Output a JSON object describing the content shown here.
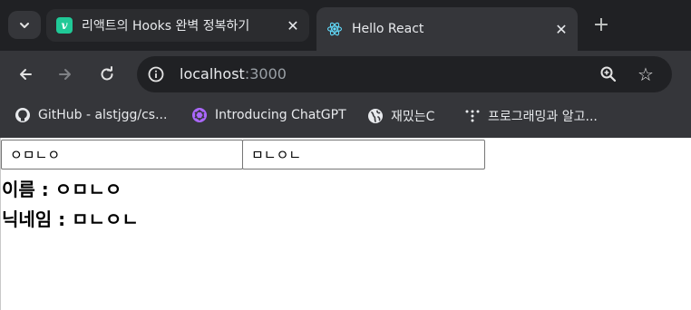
{
  "tabs": [
    {
      "title": "리액트의 Hooks 완벽 정복하기",
      "favicon": "velog-v",
      "favicon_letter": "v",
      "close": "✕"
    },
    {
      "title": "Hello React",
      "favicon": "react-logo",
      "close": "✕"
    }
  ],
  "new_tab": "+",
  "address_bar": {
    "host": "localhost",
    "port": ":3000"
  },
  "bookmarks": [
    {
      "label": "GitHub - alstjgg/cs...",
      "icon": "github-icon"
    },
    {
      "label": "Introducing ChatGPT",
      "icon": "openai-icon"
    },
    {
      "label": "재밌는C",
      "icon": "globe-icon"
    },
    {
      "label": "프로그래밍과 알고...",
      "icon": "dots-icon"
    }
  ],
  "form": {
    "name_value": "ㅇㅁㄴㅇ",
    "nickname_value": "ㅁㄴㅇㄴ"
  },
  "display": {
    "name_label": "이름 :",
    "name_value": "ㅇㅁㄴㅇ",
    "nickname_label": "닉네임 :",
    "nickname_value": "ㅁㄴㅇㄴ"
  },
  "colors": {
    "chrome_dark": "#202124",
    "chrome_toolbar": "#35363a",
    "velog_green": "#20c997",
    "react_blue": "#61dafb"
  }
}
